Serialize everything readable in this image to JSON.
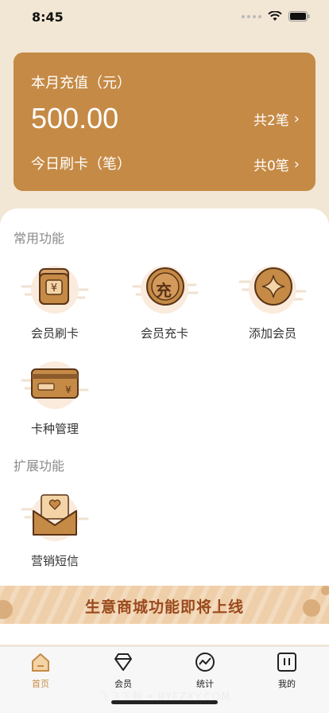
{
  "status": {
    "time": "8:45"
  },
  "summary": {
    "recharge_label": "本月充值（元）",
    "recharge_amount": "500.00",
    "recharge_count": "共2笔",
    "swipe_label": "今日刷卡（笔）",
    "swipe_count": "共0笔"
  },
  "sections": {
    "common_title": "常用功能",
    "extension_title": "扩展功能"
  },
  "functions": [
    {
      "label": "会员刷卡",
      "icon": "yen-wallet-icon"
    },
    {
      "label": "会员充卡",
      "icon": "recharge-coin-icon",
      "glyph": "充"
    },
    {
      "label": "添加会员",
      "icon": "star-coin-icon"
    },
    {
      "label": "卡种管理",
      "icon": "card-icon"
    }
  ],
  "extensions": [
    {
      "label": "营销短信",
      "icon": "heart-envelope-icon"
    }
  ],
  "banner": {
    "text": "生意商城功能即将上线"
  },
  "tabs": [
    {
      "label": "首页",
      "icon": "home-icon",
      "active": true
    },
    {
      "label": "会员",
      "icon": "diamond-icon",
      "active": false
    },
    {
      "label": "统计",
      "icon": "chart-icon",
      "active": false
    },
    {
      "label": "我的",
      "icon": "profile-icon",
      "active": false
    }
  ],
  "watermark": "飞飞下载 • BYFZXY.COM",
  "colors": {
    "accent": "#C58A45",
    "background": "#F2E6D4",
    "banner": "#EFCFA9",
    "banner_text": "#9A4A1E"
  }
}
